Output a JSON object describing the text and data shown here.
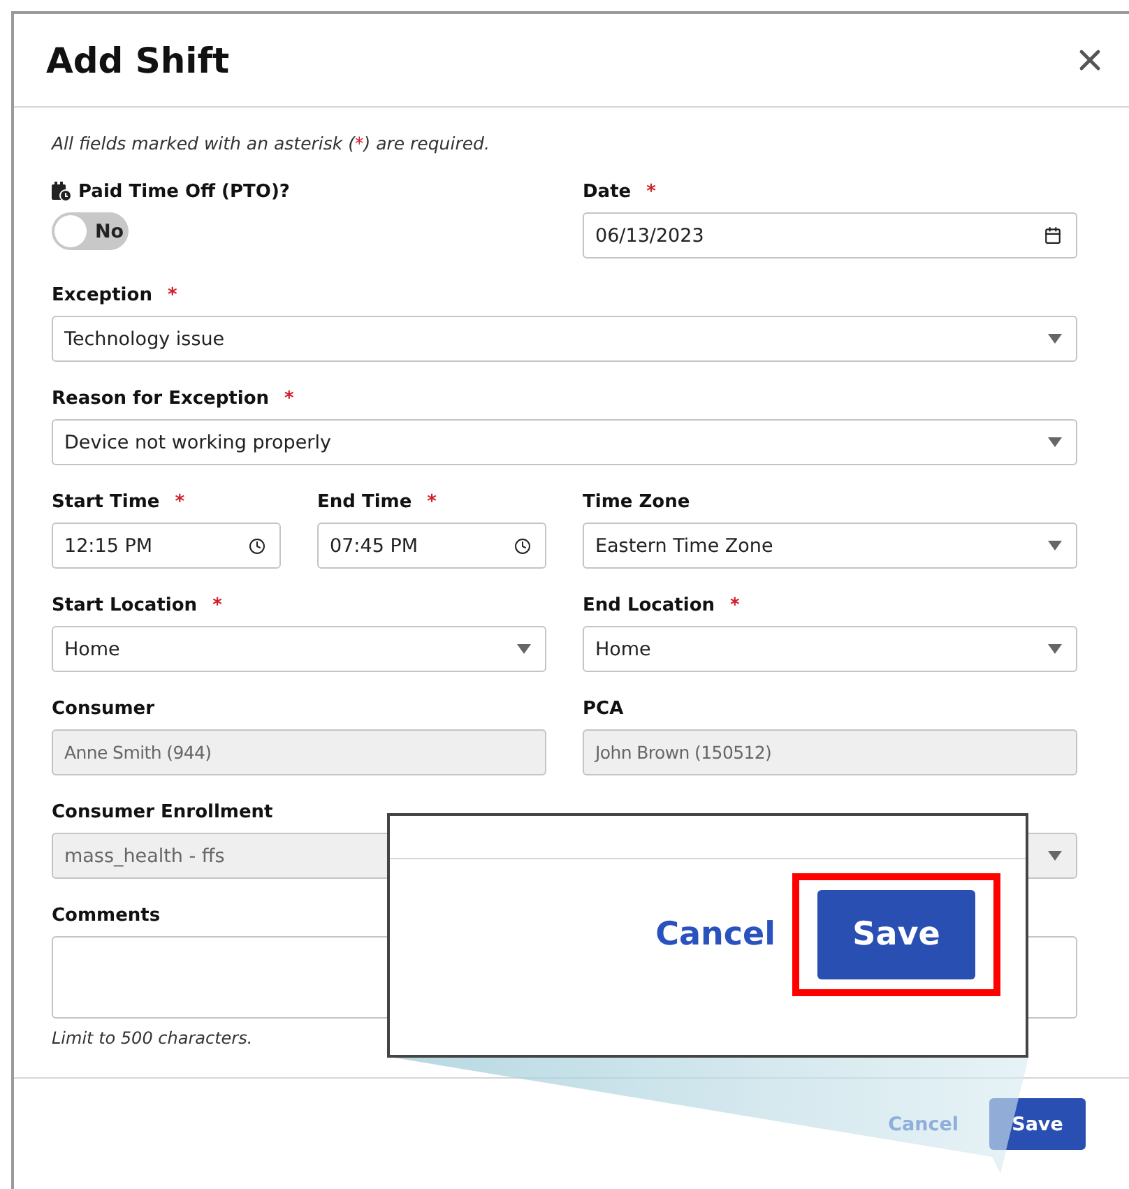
{
  "dialog": {
    "title": "Add Shift"
  },
  "required_note": {
    "before": "All fields marked with an asterisk (",
    "mark": "*",
    "after": ") are required."
  },
  "required_mark": "*",
  "rows": [
    {
      "fields": [
        {
          "kind": "toggle",
          "label": "Paid Time Off (PTO)?",
          "required": false,
          "on": false,
          "value": "No"
        },
        {
          "kind": "date",
          "label": "Date",
          "required": true,
          "value": "06/13/2023"
        }
      ]
    },
    {
      "fields": [
        {
          "kind": "select",
          "label": "Exception",
          "required": true,
          "value": "Technology issue"
        }
      ]
    },
    {
      "fields": [
        {
          "kind": "select",
          "label": "Reason for Exception",
          "required": true,
          "value": "Device not working properly"
        }
      ]
    },
    {
      "fields": [
        {
          "kind": "time",
          "label": "Start Time",
          "required": true,
          "value": "12:15 PM"
        },
        {
          "kind": "time",
          "label": "End Time",
          "required": true,
          "value": "07:45 PM"
        },
        {
          "kind": "select",
          "label": "Time Zone",
          "required": false,
          "value": "Eastern Time Zone"
        }
      ]
    },
    {
      "fields": [
        {
          "kind": "select",
          "label": "Start Location",
          "required": true,
          "value": "Home"
        },
        {
          "kind": "select",
          "label": "End Location",
          "required": true,
          "value": "Home"
        }
      ]
    },
    {
      "fields": [
        {
          "kind": "text",
          "label": "Consumer",
          "required": false,
          "disabled": true,
          "value": "Anne Smith (944)"
        },
        {
          "kind": "text",
          "label": "PCA",
          "required": false,
          "disabled": true,
          "value": "John Brown (150512)"
        }
      ]
    },
    {
      "fields": [
        {
          "kind": "select",
          "label": "Consumer Enrollment",
          "required": false,
          "disabled": true,
          "value": "mass_health - ffs"
        }
      ]
    },
    {
      "fields": [
        {
          "kind": "textarea",
          "label": "Comments",
          "required": false,
          "hint": "Limit to 500 characters."
        }
      ]
    }
  ],
  "footer": {
    "cancel": "Cancel",
    "save": "Save"
  },
  "callout": {
    "cancel": "Cancel",
    "save": "Save",
    "highlighted": true
  }
}
